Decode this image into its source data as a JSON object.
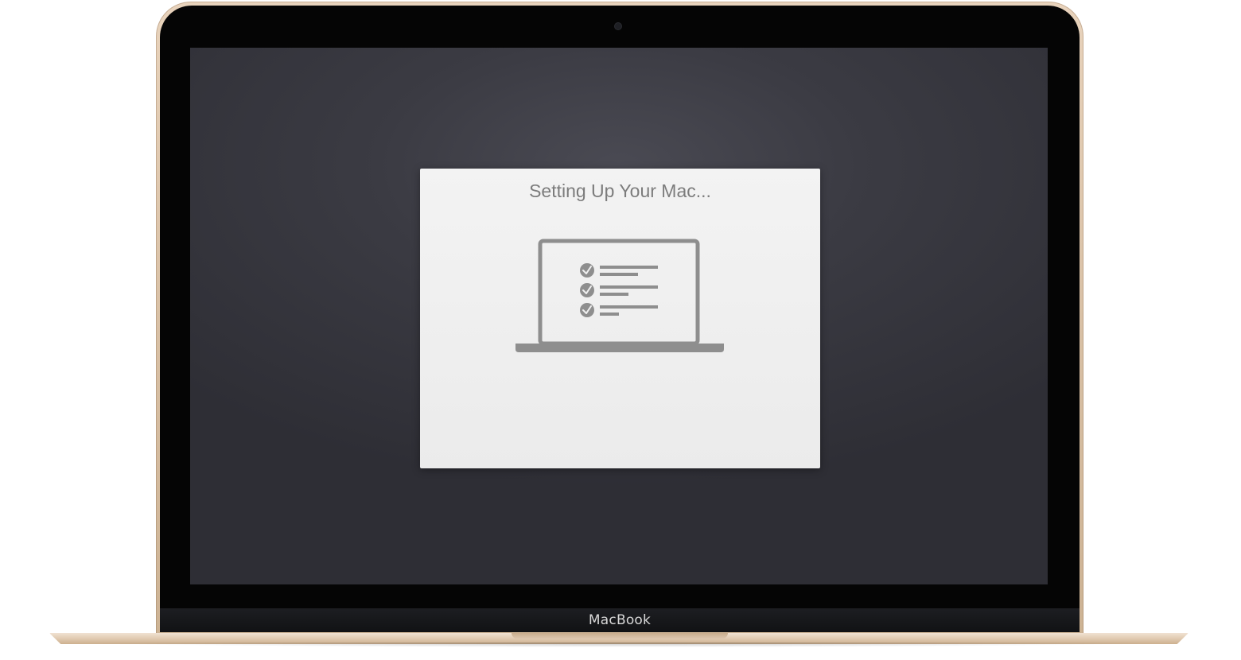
{
  "device": {
    "model_label": "MacBook"
  },
  "dialog": {
    "title": "Setting Up Your Mac...",
    "illustration_icon": "laptop-checklist-icon",
    "checklist_items": [
      {
        "icon": "checkmark-circle-icon",
        "state": "checked"
      },
      {
        "icon": "checkmark-circle-icon",
        "state": "checked"
      },
      {
        "icon": "checkmark-circle-icon",
        "state": "checked"
      }
    ]
  },
  "colors": {
    "screen_background": "#3b3b43",
    "dialog_background": "#efefef",
    "title_text": "#7c7c7c",
    "illustration": "#8e8e8e",
    "frame_gold": "#d9c1a6"
  }
}
